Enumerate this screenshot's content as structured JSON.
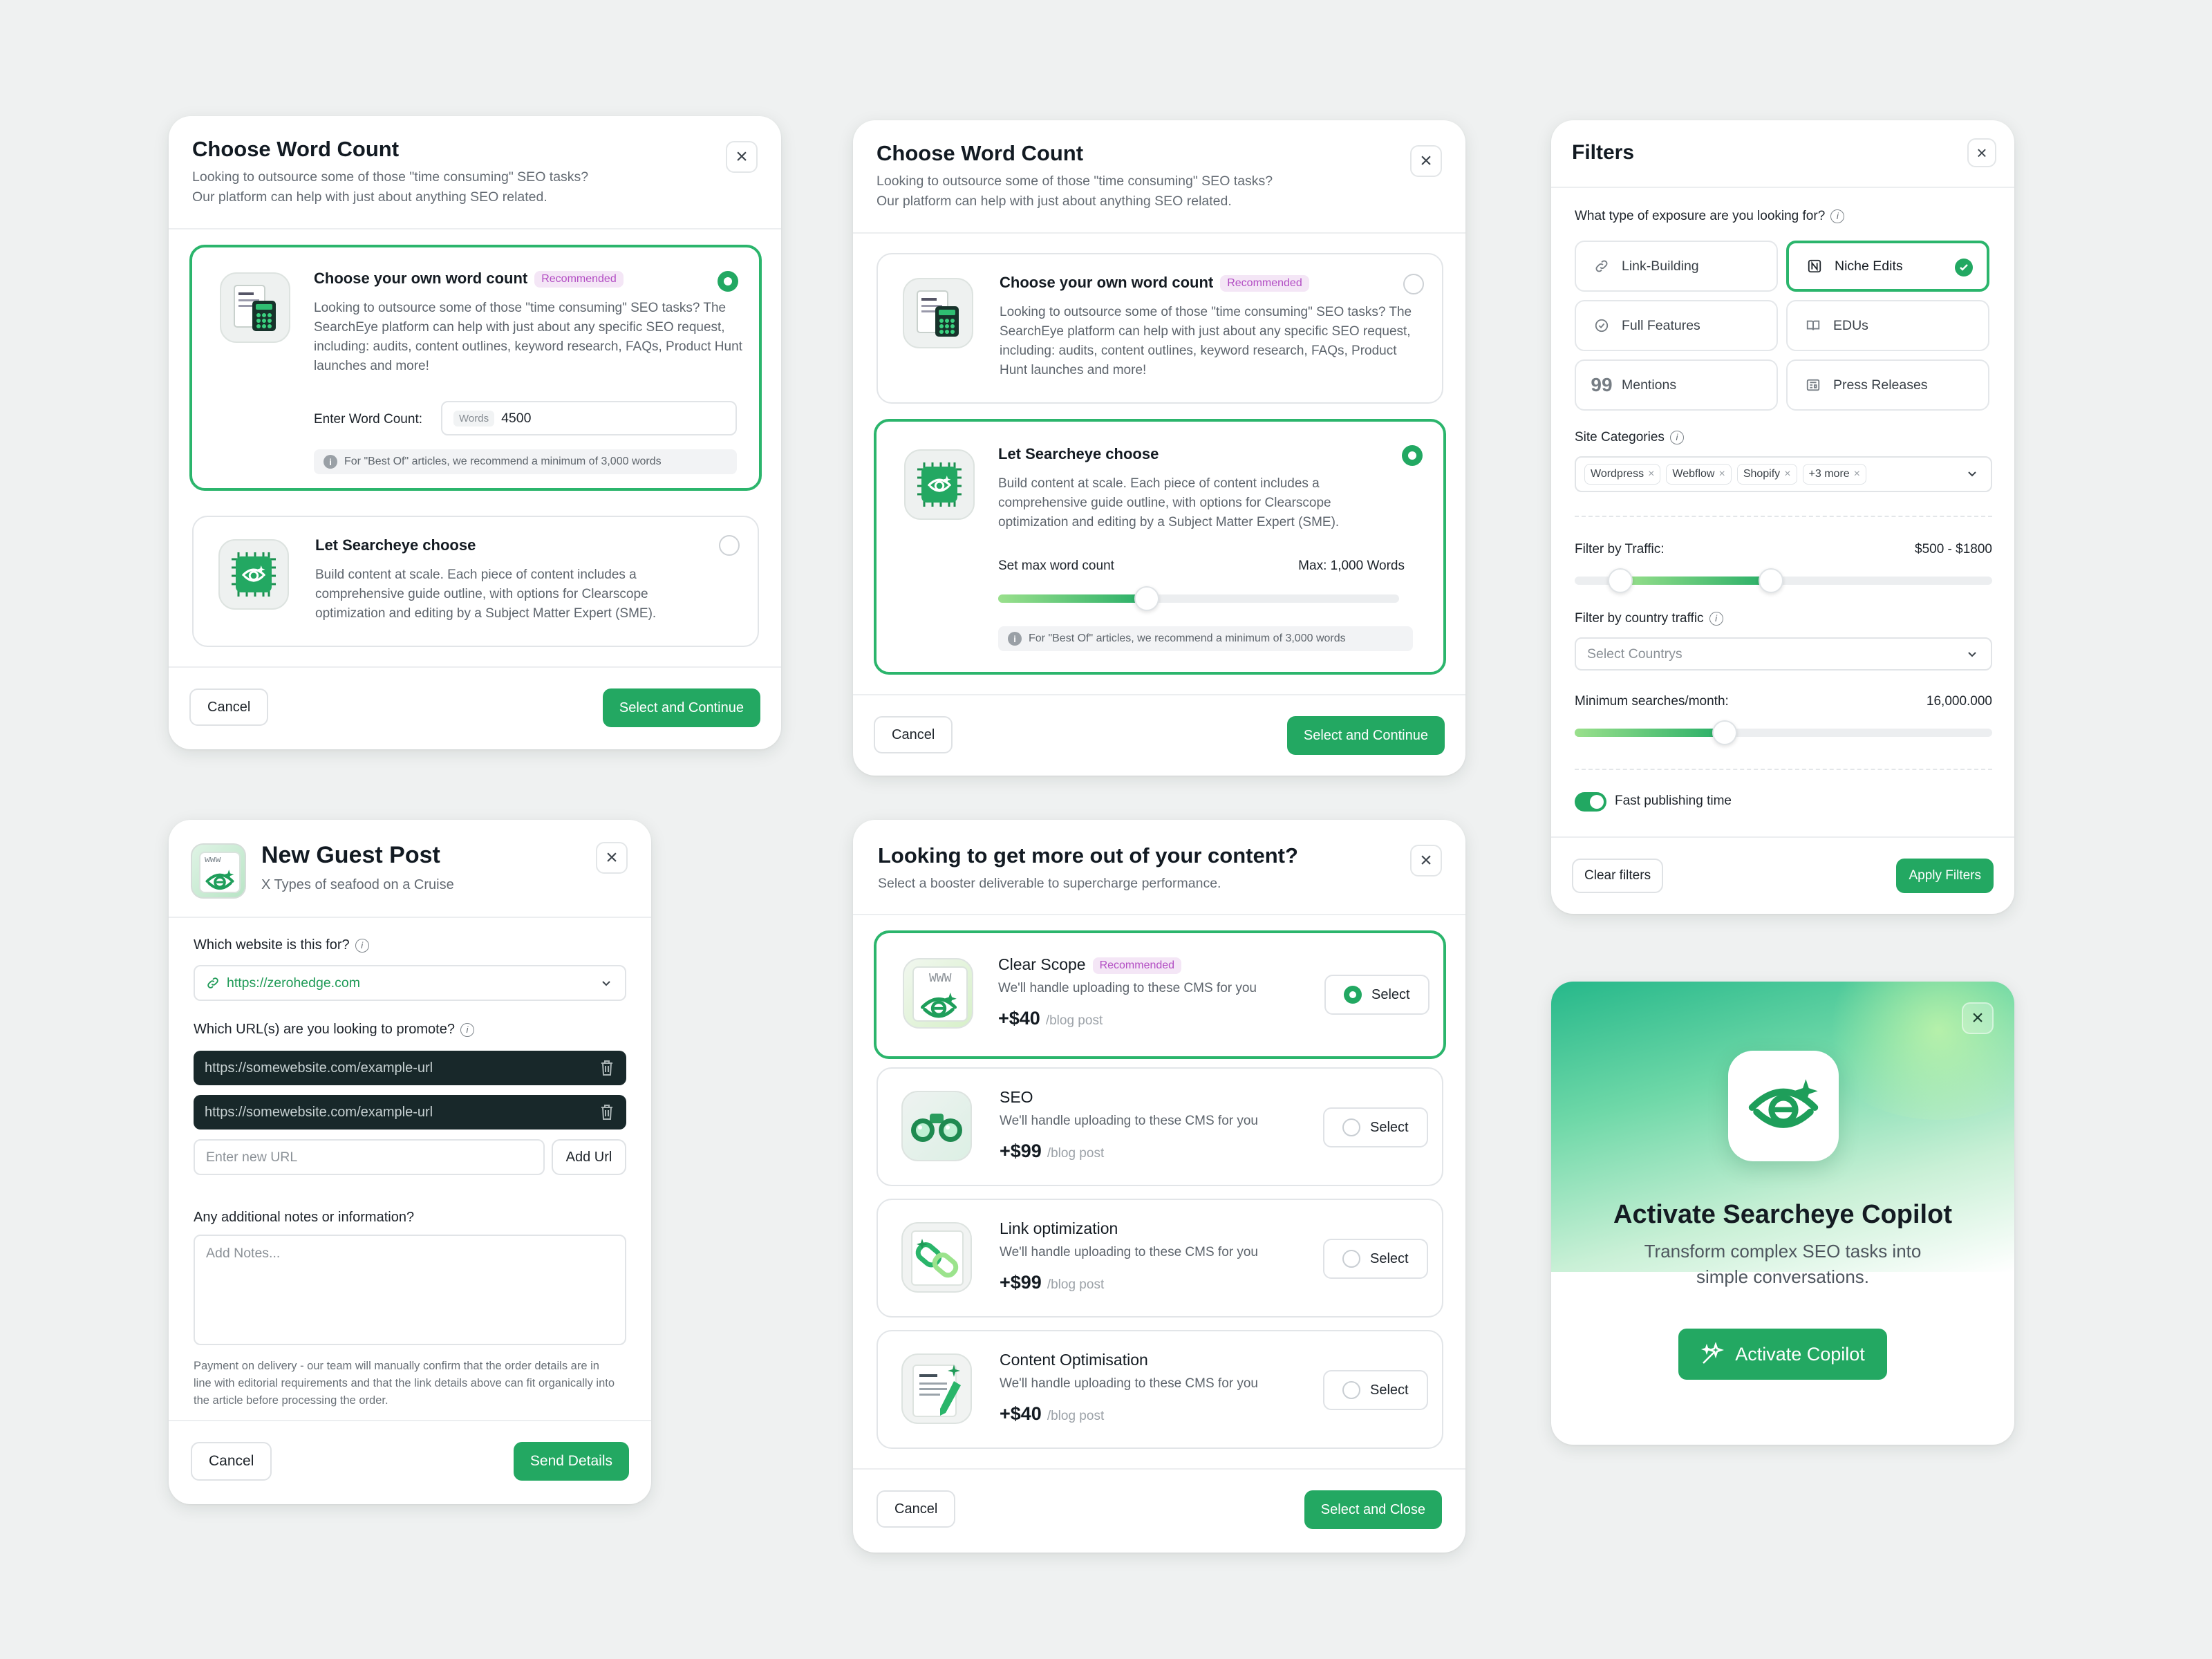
{
  "word_count_a": {
    "title": "Choose Word Count",
    "subtitle_1": "Looking to outsource some of those \"time consuming\" SEO tasks?",
    "subtitle_2": "Our platform can help with just about anything SEO related.",
    "option_own": {
      "title": "Choose your own word count",
      "badge": "Recommended",
      "desc": "Looking to outsource some of those \"time consuming\" SEO tasks? The SearchEye platform can help with just about any specific SEO request, including: audits, content outlines, keyword research, FAQs, Product Hunt launches and more!",
      "input_label": "Enter Word Count:",
      "input_prefix": "Words",
      "input_value": "4500",
      "note": "For \"Best Of\" articles, we recommend a minimum of 3,000 words",
      "selected": true
    },
    "option_searcheye": {
      "title": "Let Searcheye choose",
      "desc": "Build content at scale. Each piece of content includes a comprehensive guide outline, with options for Clearscope optimization and editing by a Subject Matter Expert (SME).",
      "selected": false
    },
    "cancel": "Cancel",
    "continue": "Select and Continue"
  },
  "word_count_b": {
    "title": "Choose Word Count",
    "subtitle_1": "Looking to outsource some of those \"time consuming\" SEO tasks?",
    "subtitle_2": "Our platform can help with just about anything SEO related.",
    "option_own": {
      "title": "Choose your own word count",
      "badge": "Recommended",
      "desc": "Looking to outsource some of those \"time consuming\" SEO tasks? The SearchEye platform can help with just about any specific SEO request, including: audits, content outlines, keyword research, FAQs, Product Hunt launches and more!",
      "selected": false
    },
    "option_searcheye": {
      "title": "Let Searcheye choose",
      "desc": "Build content at scale. Each piece of content includes a comprehensive guide outline, with options for Clearscope optimization and editing by a Subject Matter Expert (SME).",
      "slider_label": "Set max word count",
      "slider_max": "Max: 1,000 Words",
      "slider_fraction": 0.37,
      "note": "For \"Best Of\" articles, we recommend a minimum of 3,000 words",
      "selected": true
    },
    "cancel": "Cancel",
    "continue": "Select and Continue"
  },
  "filters": {
    "title": "Filters",
    "exposure_question": "What type of exposure are you looking for?",
    "exposure_options": [
      {
        "label": "Link-Building",
        "icon": "link-icon",
        "selected": false
      },
      {
        "label": "Niche Edits",
        "icon": "notion-icon",
        "selected": true
      },
      {
        "label": "Full Features",
        "icon": "badge-check-icon",
        "selected": false
      },
      {
        "label": "EDUs",
        "icon": "book-icon",
        "selected": false
      },
      {
        "label": "Mentions",
        "icon": "quote-icon",
        "selected": false
      },
      {
        "label": "Press Releases",
        "icon": "newspaper-icon",
        "selected": false
      }
    ],
    "site_categories_label": "Site Categories",
    "categories": [
      "Wordpress",
      "Webflow",
      "Shopify",
      "+3 more"
    ],
    "traffic_label": "Filter by Traffic:",
    "traffic_value": "$500 - $1800",
    "traffic_range_fraction": [
      0.11,
      0.47
    ],
    "country_label": "Filter by country traffic",
    "country_placeholder": "Select Countrys",
    "searches_label": "Minimum searches/month:",
    "searches_value": "16,000.000",
    "searches_fraction": 0.36,
    "fast_label": "Fast publishing time",
    "fast_on": true,
    "clear": "Clear filters",
    "apply": "Apply Filters"
  },
  "guest_post": {
    "title": "New Guest Post",
    "subtitle": "X Types of seafood on a Cruise",
    "website_label": "Which website is this for?",
    "website_value": "https://zerohedge.com",
    "urls_label": "Which URL(s) are you looking to promote?",
    "urls": [
      "https://somewebsite.com/example-url",
      "https://somewebsite.com/example-url"
    ],
    "new_url_placeholder": "Enter new URL",
    "add_url": "Add Url",
    "notes_label": "Any additional notes or information?",
    "notes_placeholder": "Add Notes...",
    "payment_note": "Payment on delivery - our team will manually confirm that the order details are in line with editorial requirements and that the link details above can fit organically into the article before processing the order.",
    "cancel": "Cancel",
    "send": "Send Details"
  },
  "booster": {
    "title": "Looking to get more out of your content?",
    "subtitle": "Select a booster deliverable to supercharge performance.",
    "items": [
      {
        "title": "Clear Scope",
        "badge": "Recommended",
        "desc": "We'll handle uploading to these CMS for you",
        "price": "+$40",
        "unit": "/blog post",
        "select": "Select",
        "selected": true,
        "icon": "www-eye-icon"
      },
      {
        "title": "SEO",
        "badge": "",
        "desc": "We'll handle uploading to these CMS for you",
        "price": "+$99",
        "unit": "/blog post",
        "select": "Select",
        "selected": false,
        "icon": "binoculars-icon"
      },
      {
        "title": "Link optimization",
        "badge": "",
        "desc": "We'll handle uploading to these CMS for you",
        "price": "+$99",
        "unit": "/blog post",
        "select": "Select",
        "selected": false,
        "icon": "chain-link-icon"
      },
      {
        "title": "Content Optimisation",
        "badge": "",
        "desc": "We'll handle uploading to these CMS for you",
        "price": "+$40",
        "unit": "/blog post",
        "select": "Select",
        "selected": false,
        "icon": "document-pen-icon"
      }
    ],
    "cancel": "Cancel",
    "close": "Select and Close"
  },
  "copilot": {
    "title": "Activate Searcheye Copilot",
    "subtitle_1": "Transform complex SEO tasks into",
    "subtitle_2": "simple conversations.",
    "button": "Activate Copilot"
  },
  "colors": {
    "accent": "#23a862",
    "accent_dark": "#18282a",
    "badge_text": "#b24cc3",
    "badge_bg": "#f4e6f6"
  }
}
